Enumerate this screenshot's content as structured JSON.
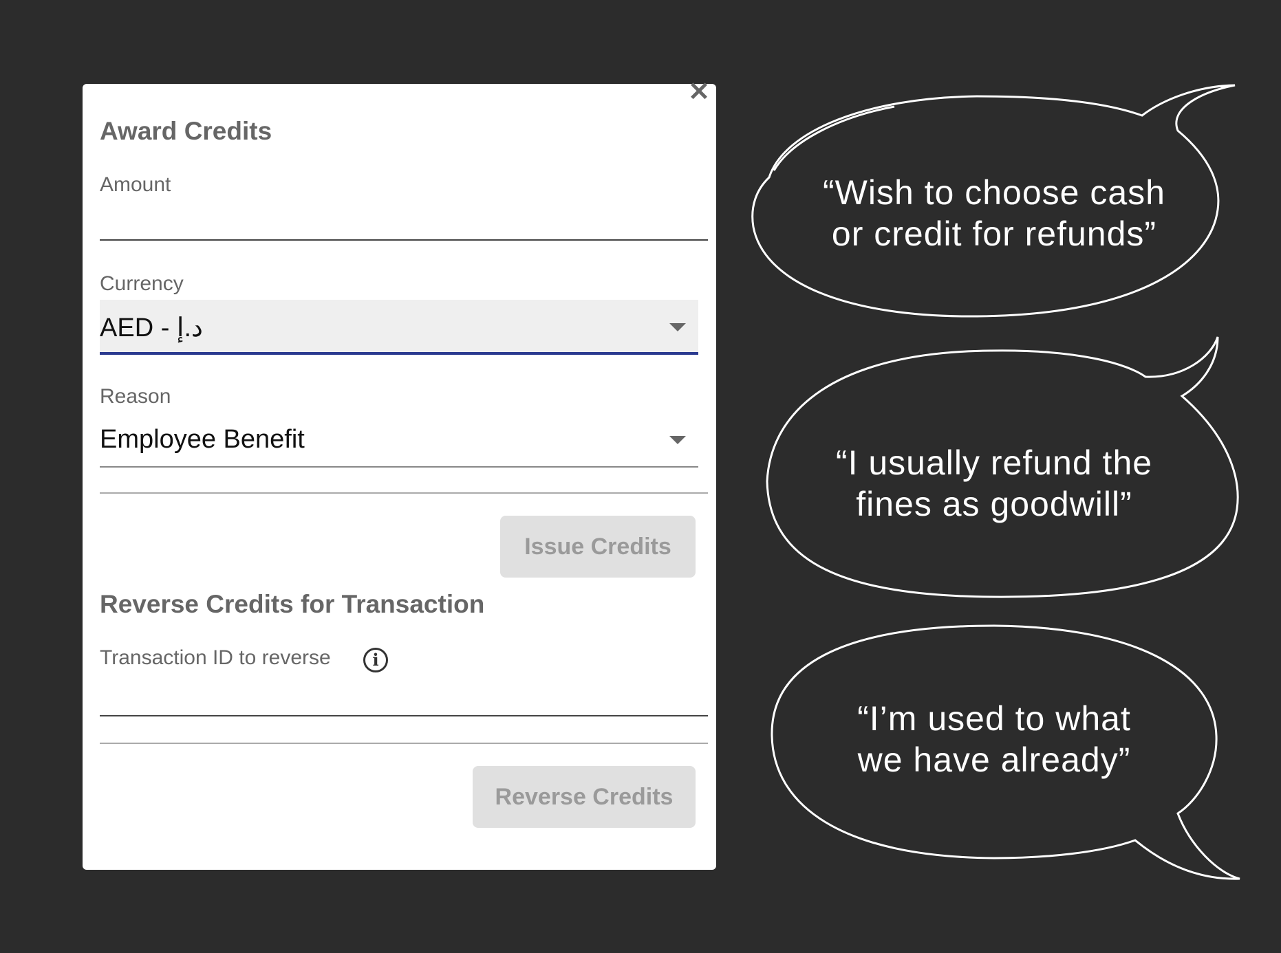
{
  "dialog": {
    "close_icon": "close-icon",
    "award_title": "Award Credits",
    "amount_label": "Amount",
    "amount_value": "",
    "currency_label": "Currency",
    "currency_value": "AED - د.إ",
    "reason_label": "Reason",
    "reason_value": "Employee Benefit",
    "issue_button": "Issue Credits",
    "reverse_title": "Reverse Credits for Transaction",
    "txn_label": "Transaction ID to reverse",
    "txn_value": "",
    "reverse_button": "Reverse Credits"
  },
  "bubbles": [
    {
      "line1": "“Wish to choose cash",
      "line2": "or credit for refunds”"
    },
    {
      "line1": "“I usually refund the",
      "line2": "fines as goodwill”"
    },
    {
      "line1": "“I’m used to what",
      "line2": "we have already”"
    }
  ],
  "colors": {
    "background": "#2c2c2c",
    "focus_underline": "#2b3a8f",
    "disabled_button": "#e0e0e0"
  }
}
